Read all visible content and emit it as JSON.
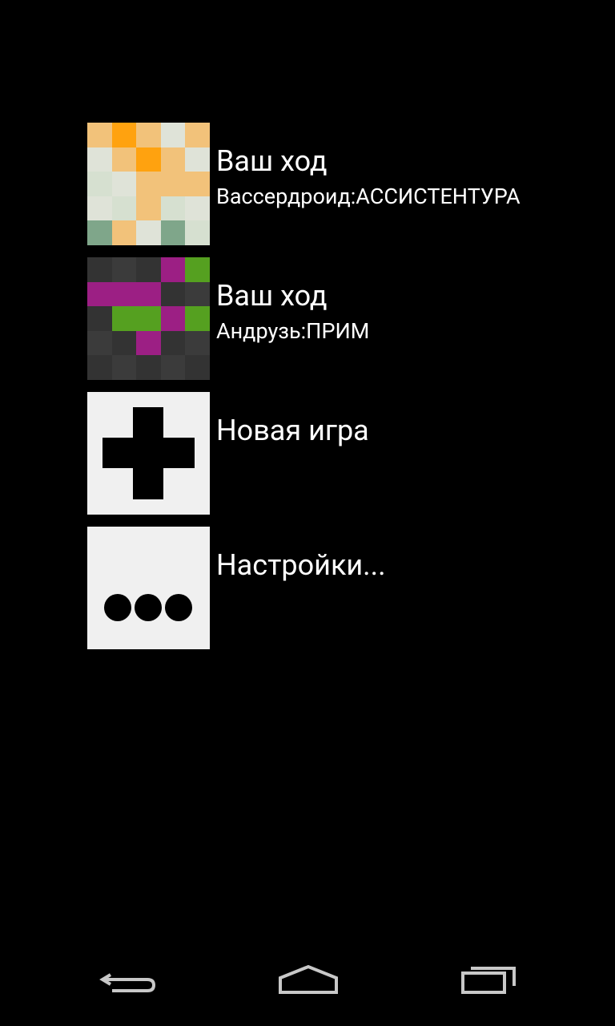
{
  "games": [
    {
      "title": "Ваш ход",
      "subtitle": "Вассердроид:АССИСТЕНТУРА",
      "thumb_colors": [
        "#f2c27a",
        "#ffa20f",
        "#f2c27a",
        "#dfe3d8",
        "#f2c27a",
        "#dfe3d8",
        "#f2c27a",
        "#ffa20f",
        "#f2c27a",
        "#dfe3d8",
        "#d6e0d0",
        "#dfe3d8",
        "#f2c27a",
        "#f2c27a",
        "#f2c27a",
        "#dfe3d8",
        "#d6e0d0",
        "#f2c27a",
        "#d6e0d0",
        "#dfe3d8",
        "#7fa68a",
        "#f2c27a",
        "#dfe3d8",
        "#7fa68a",
        "#d6e0d0"
      ]
    },
    {
      "title": "Ваш ход",
      "subtitle": "Андрузь:ПРИМ",
      "thumb_colors": [
        "#333333",
        "#3b3b3b",
        "#333333",
        "#9c1f84",
        "#55a020",
        "#9c1f84",
        "#9c1f84",
        "#9c1f84",
        "#333333",
        "#3b3b3b",
        "#333333",
        "#55a020",
        "#55a020",
        "#9c1f84",
        "#55a020",
        "#3b3b3b",
        "#333333",
        "#9c1f84",
        "#333333",
        "#3b3b3b",
        "#333333",
        "#3b3b3b",
        "#333333",
        "#3b3b3b",
        "#333333"
      ]
    }
  ],
  "new_game": {
    "label": "Новая игра",
    "icon": "plus-icon"
  },
  "settings": {
    "label": "Настройки...",
    "icon": "more-dots-icon"
  },
  "navbar": {
    "back_icon": "back-icon",
    "home_icon": "home-icon",
    "recents_icon": "recents-icon"
  }
}
